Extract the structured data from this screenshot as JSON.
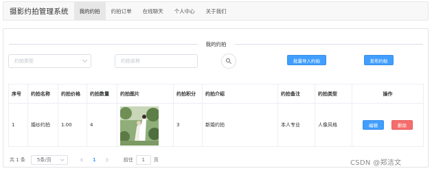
{
  "brand": "摄影约拍管理系统",
  "nav": {
    "items": [
      "我的约拍",
      "约拍订单",
      "在线聊天",
      "个人中心",
      "关于我们"
    ]
  },
  "section_title": "我的约拍",
  "filters": {
    "type_placeholder": "约拍类型",
    "name_placeholder": "约拍名称"
  },
  "actions": {
    "import_label": "批量导入约拍",
    "publish_label": "发布约拍"
  },
  "table": {
    "headers": [
      "序号",
      "约拍名称",
      "约拍价格",
      "约拍数量",
      "约拍图片",
      "约拍积分",
      "约拍介绍",
      "约拍备注",
      "约拍类型",
      "操作"
    ],
    "rows": [
      {
        "index": "1",
        "name": "婚纱约拍",
        "price": "1.00",
        "quantity": "4",
        "points": "3",
        "intro": "新婚约拍",
        "remark": "本人专业",
        "type": "人像风格",
        "edit_label": "编辑",
        "delete_label": "删除"
      }
    ]
  },
  "pagination": {
    "total": "共 1 条",
    "page_size": "5条/页",
    "current_page": "1",
    "goto_label": "前往",
    "goto_value": "1",
    "page_suffix": "页"
  },
  "watermark": "CSDN @郑洁文",
  "colors": {
    "primary": "#409eff",
    "danger": "#f56c6c",
    "border": "#dcdfe6"
  }
}
